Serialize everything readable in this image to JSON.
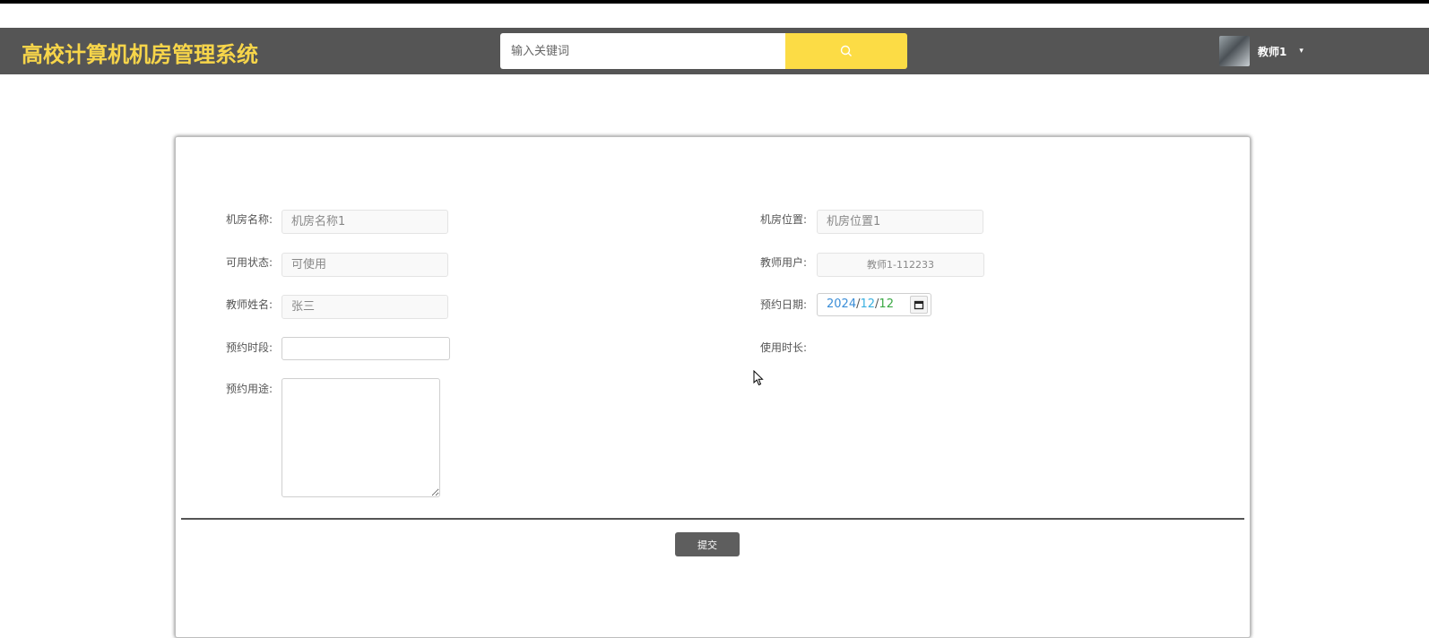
{
  "header": {
    "logo": "高校计算机机房管理系统",
    "search_placeholder": "输入关键词",
    "username": "教师1",
    "caret": "▾"
  },
  "form": {
    "room_name": {
      "label": "机房名称:",
      "value": "机房名称1"
    },
    "room_location": {
      "label": "机房位置:",
      "value": "机房位置1"
    },
    "status": {
      "label": "可用状态:",
      "value": "可使用"
    },
    "teacher_user": {
      "label": "教师用户:",
      "value": "教师1-112233"
    },
    "teacher_name": {
      "label": "教师姓名:",
      "value": "张三"
    },
    "booking_date": {
      "label": "预约日期:",
      "year": "2024",
      "month": "12",
      "day": "12",
      "sep": "/"
    },
    "time_slot": {
      "label": "预约时段:",
      "value": ""
    },
    "duration": {
      "label": "使用时长:"
    },
    "purpose": {
      "label": "预约用途:",
      "value": ""
    },
    "submit_label": "提交"
  },
  "colors": {
    "header_bg": "#555555",
    "logo": "#f7d54a",
    "search_button": "#fcdc45",
    "submit_bg": "#5e5e5e"
  }
}
